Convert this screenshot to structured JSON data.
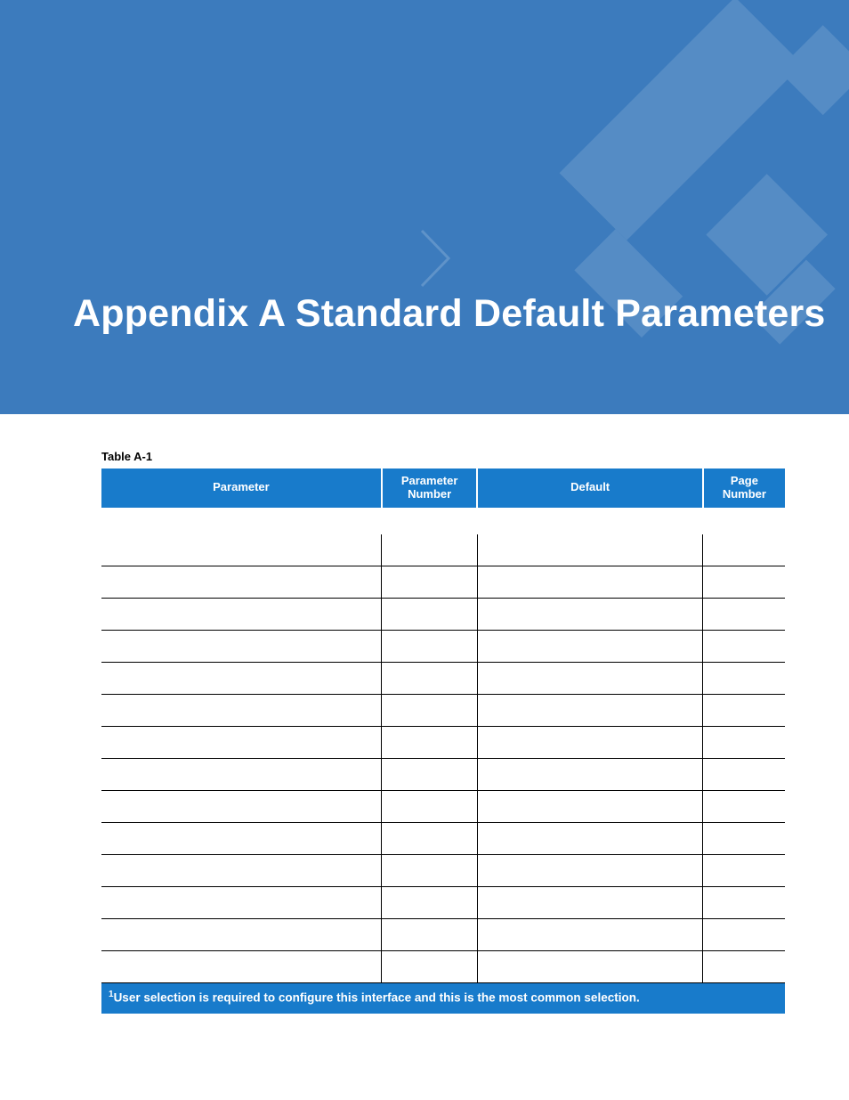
{
  "header": {
    "title": "Appendix A Standard Default Parameters"
  },
  "table": {
    "caption": "Table A-1",
    "columns": {
      "parameter": "Parameter",
      "parameter_number_l1": "Parameter",
      "parameter_number_l2": "Number",
      "default": "Default",
      "page_number_l1": "Page",
      "page_number_l2": "Number"
    },
    "section_label": "",
    "rows": [
      {
        "parameter": "",
        "number": "",
        "default": "",
        "page": ""
      },
      {
        "parameter": "",
        "number": "",
        "default": "",
        "page": ""
      },
      {
        "parameter": "",
        "number": "",
        "default": "",
        "page": ""
      },
      {
        "parameter": "",
        "number": "",
        "default": "",
        "page": ""
      },
      {
        "parameter": "",
        "number": "",
        "default": "",
        "page": ""
      },
      {
        "parameter": "",
        "number": "",
        "default": "",
        "page": ""
      },
      {
        "parameter": "",
        "number": "",
        "default": "",
        "page": ""
      },
      {
        "parameter": "",
        "number": "",
        "default": "",
        "page": ""
      },
      {
        "parameter": "",
        "number": "",
        "default": "",
        "page": ""
      },
      {
        "parameter": "",
        "number": "",
        "default": "",
        "page": ""
      },
      {
        "parameter": "",
        "number": "",
        "default": "",
        "page": ""
      },
      {
        "parameter": "",
        "number": "",
        "default": "",
        "page": ""
      },
      {
        "parameter": "",
        "number": "",
        "default": "",
        "page": ""
      },
      {
        "parameter": "",
        "number": "",
        "default": "",
        "page": ""
      }
    ],
    "footnote_marker": "1",
    "footnote_text": "User selection is required to configure this interface and this is the most common selection."
  },
  "colors": {
    "header_band": "#3c7bbd",
    "table_header": "#187bcb",
    "rule": "#000000"
  }
}
